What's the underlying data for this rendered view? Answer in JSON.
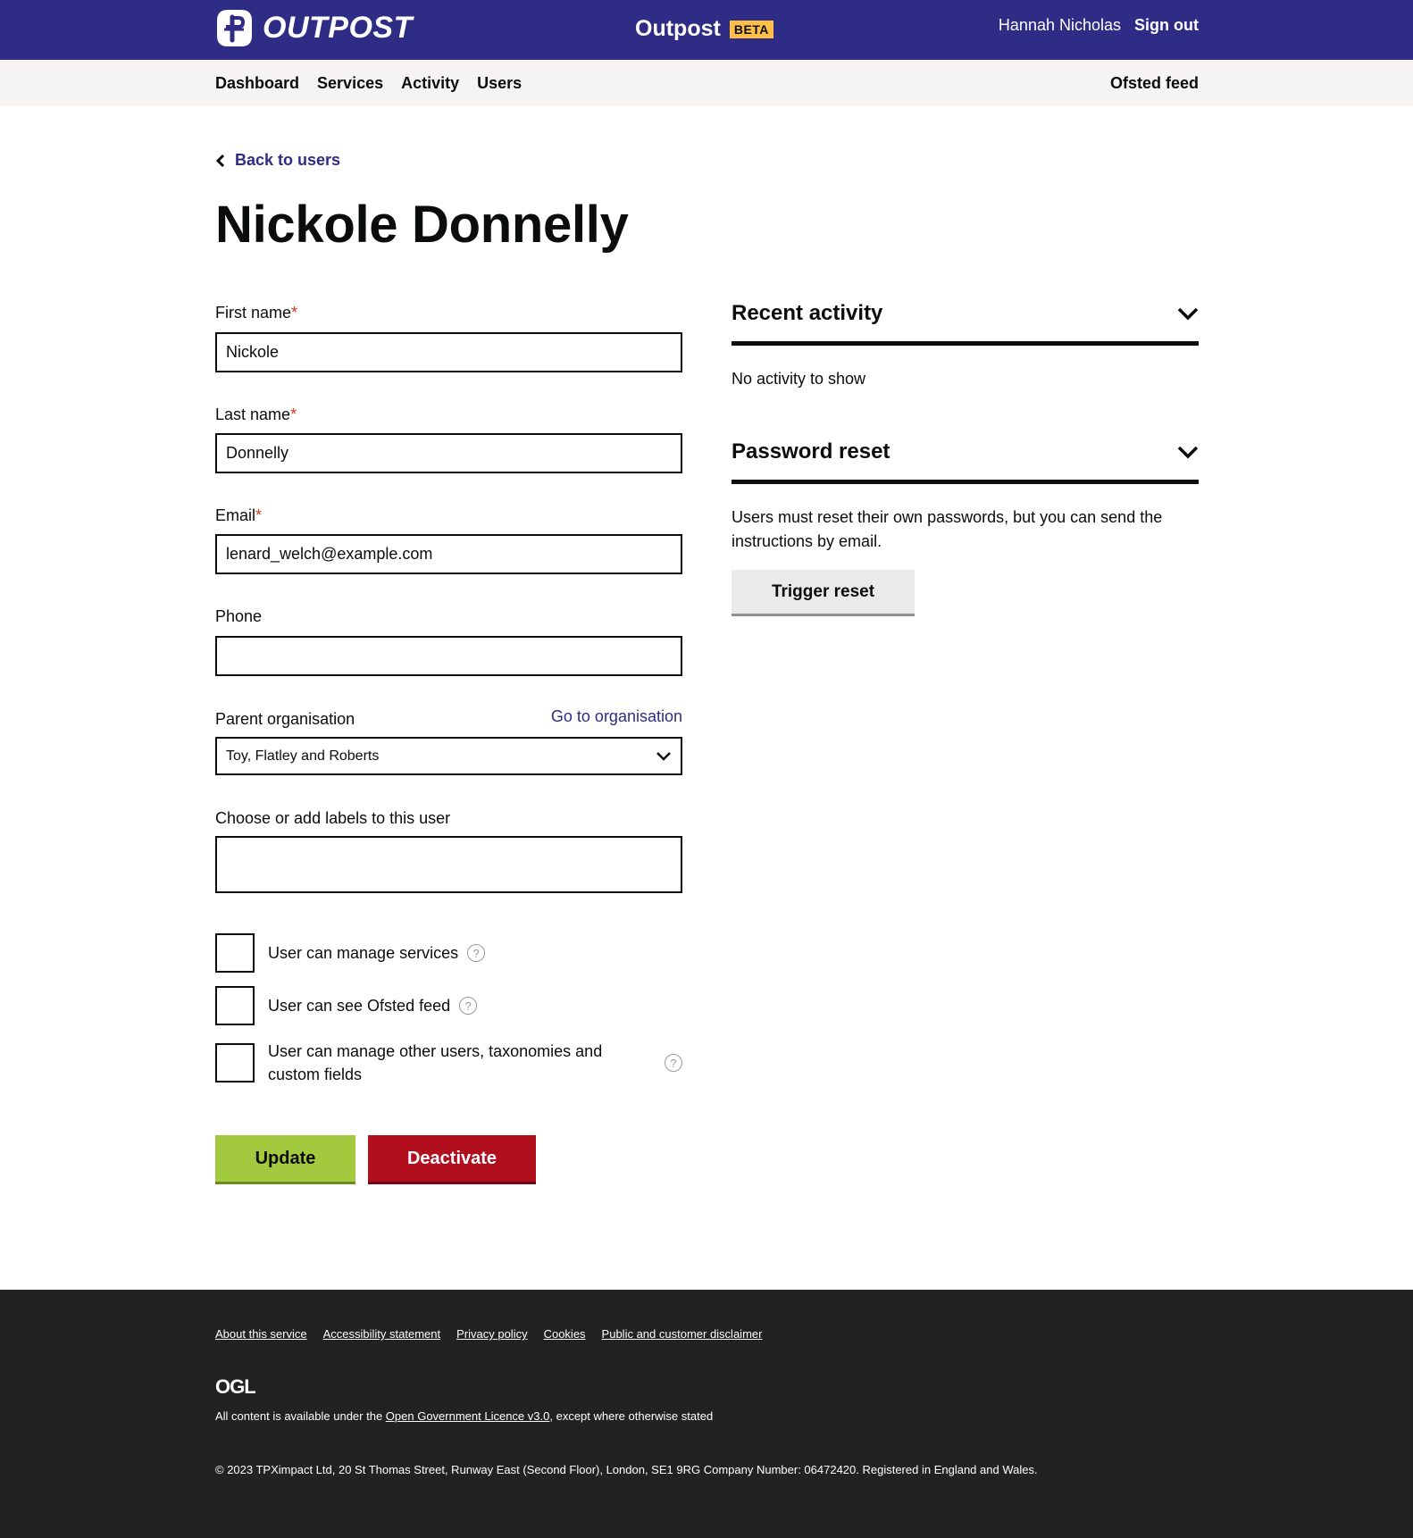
{
  "header": {
    "logo_text": "OUTPOST",
    "service_name": "Outpost",
    "beta_tag": "BETA",
    "user_name": "Hannah Nicholas",
    "sign_out": "Sign out"
  },
  "nav": {
    "items": [
      "Dashboard",
      "Services",
      "Activity",
      "Users"
    ],
    "right": "Ofsted feed"
  },
  "back_link": "Back to users",
  "page_title": "Nickole Donnelly",
  "form": {
    "first_name_label": "First name",
    "first_name_value": "Nickole",
    "last_name_label": "Last name",
    "last_name_value": "Donnelly",
    "email_label": "Email",
    "email_value": "lenard_welch@example.com",
    "phone_label": "Phone",
    "phone_value": "",
    "required_marker": "*",
    "parent_org_label": "Parent organisation",
    "go_to_org": "Go to organisation",
    "parent_org_value": "Toy, Flatley and Roberts",
    "labels_label": "Choose or add labels to this user",
    "checkboxes": [
      "User can manage services",
      "User can see Ofsted feed",
      "User can manage other users, taxonomies and custom fields"
    ],
    "help_glyph": "?",
    "update_button": "Update",
    "deactivate_button": "Deactivate"
  },
  "recent_activity": {
    "title": "Recent activity",
    "empty_text": "No activity to show"
  },
  "password_reset": {
    "title": "Password reset",
    "description": "Users must reset their own passwords, but you can send the instructions by email.",
    "button": "Trigger reset"
  },
  "footer": {
    "links": [
      "About this service",
      "Accessibility statement",
      "Privacy policy",
      "Cookies",
      "Public and customer disclaimer"
    ],
    "ogl": "OGL",
    "licence_prefix": "All content is available under the ",
    "licence_link": "Open Government Licence v3.0",
    "licence_suffix": ", except where otherwise stated",
    "copyright": "© 2023 TPXimpact Ltd, 20 St Thomas Street, Runway East (Second Floor), London, SE1 9RG Company Number: 06472420. Registered in England and Wales."
  },
  "colors": {
    "brand": "#2e2c85",
    "update": "#a3c93f",
    "deactivate": "#b10e1e",
    "beta": "#ffbf47"
  }
}
